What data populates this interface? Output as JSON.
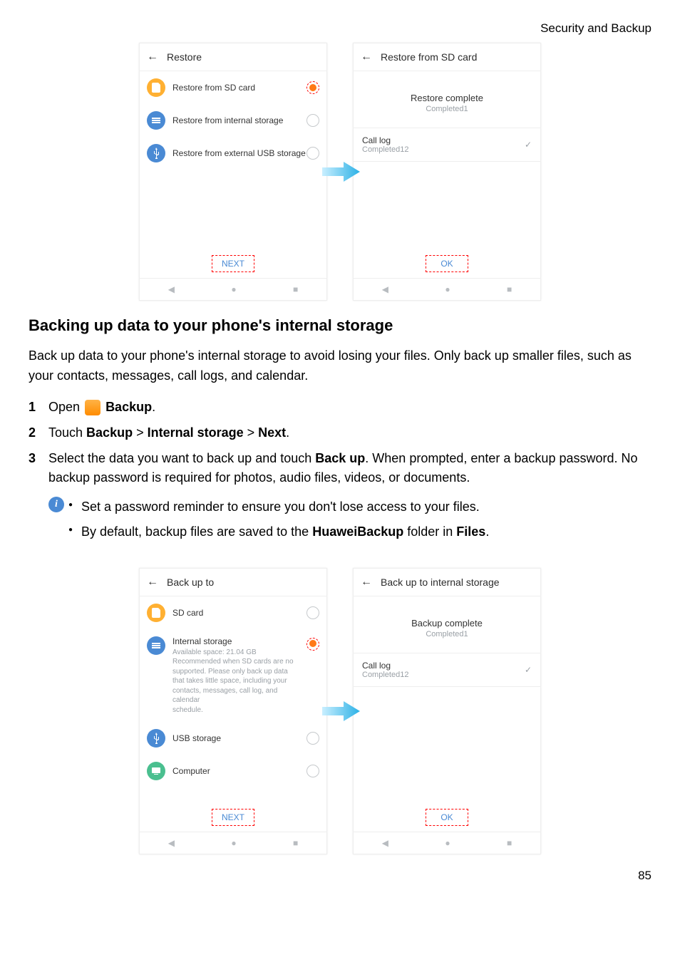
{
  "header": "Security and Backup",
  "page_number": "85",
  "screenshots_top": {
    "left": {
      "title": "Restore",
      "options": [
        {
          "label": "Restore from SD card",
          "selected": true,
          "icon": "sd"
        },
        {
          "label": "Restore from internal storage",
          "selected": false,
          "icon": "internal"
        },
        {
          "label": "Restore from external USB storage",
          "selected": false,
          "icon": "usb"
        }
      ],
      "footer_button": "NEXT"
    },
    "right": {
      "title": "Restore from SD card",
      "status_title": "Restore complete",
      "status_sub": "Completed1",
      "log_title": "Call log",
      "log_sub": "Completed12",
      "footer_button": "OK"
    }
  },
  "section_title": "Backing up data to your phone's internal storage",
  "intro_text": "Back up data to your phone's internal storage to avoid losing your files. Only back up smaller files, such as your contacts, messages, call logs, and calendar.",
  "steps": {
    "s1": {
      "pre": "Open ",
      "bold": "Backup",
      "post": "."
    },
    "s2": {
      "pre": "Touch ",
      "b1": "Backup",
      "sep1": " > ",
      "b2": "Internal storage",
      "sep2": " > ",
      "b3": "Next",
      "post": "."
    },
    "s3": {
      "pre": "Select the data you want to back up and touch ",
      "b1": "Back up",
      "post": ". When prompted, enter a backup password. No backup password is required for photos, audio files, videos, or documents."
    }
  },
  "info": {
    "bullet1": "Set a password reminder to ensure you don't lose access to your files.",
    "bullet2_pre": "By default, backup files are saved to the ",
    "bullet2_b1": "HuaweiBackup",
    "bullet2_mid": " folder in ",
    "bullet2_b2": "Files",
    "bullet2_post": "."
  },
  "screenshots_bottom": {
    "left": {
      "title": "Back up to",
      "options": [
        {
          "label": "SD card",
          "selected": false,
          "icon": "sd"
        },
        {
          "label": "Internal storage",
          "selected": true,
          "icon": "internal",
          "sub": "Available space: 21.04 GB\nRecommended when SD cards are no\nsupported. Please only back up data\nthat takes little space, including your\ncontacts, messages, call log, and calendar\nschedule."
        },
        {
          "label": "USB storage",
          "selected": false,
          "icon": "usb"
        },
        {
          "label": "Computer",
          "selected": false,
          "icon": "computer"
        }
      ],
      "footer_button": "NEXT"
    },
    "right": {
      "title": "Back up to internal storage",
      "status_title": "Backup complete",
      "status_sub": "Completed1",
      "log_title": "Call log",
      "log_sub": "Completed12",
      "footer_button": "OK"
    }
  }
}
